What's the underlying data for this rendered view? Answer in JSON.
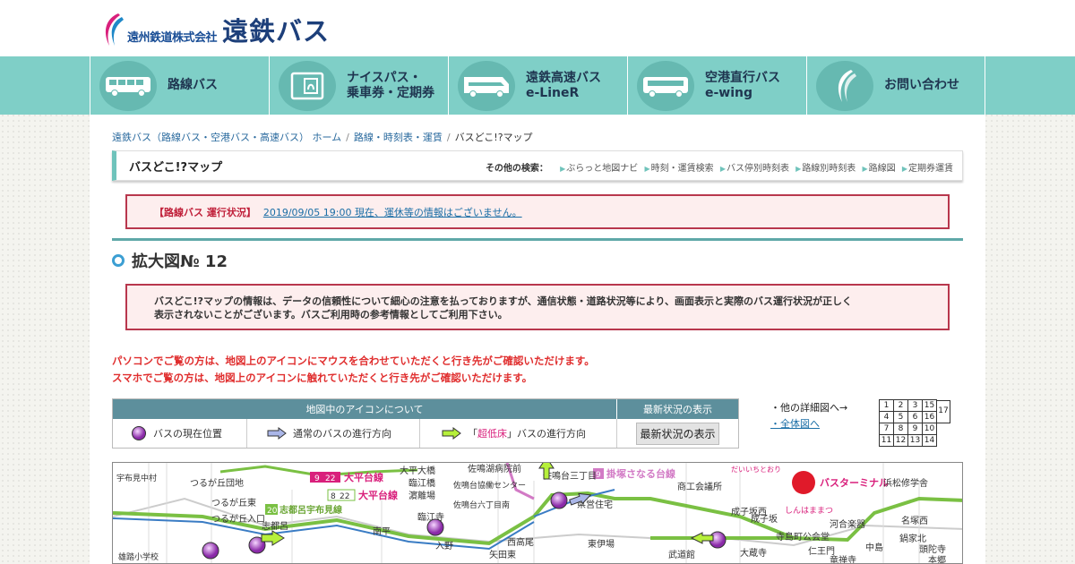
{
  "header": {
    "company": "遠州鉄道株式会社",
    "brand": "遠鉄バス",
    "colors": {
      "brand_blue": "#1d3f7a",
      "accent_pink": "#d9207c",
      "accent_teal": "#7fcfc7"
    }
  },
  "nav": {
    "items": [
      {
        "label1": "路線バス",
        "label2": "",
        "icon": "bus-icon"
      },
      {
        "label1": "ナイスパス・",
        "label2": "乗車券・定期券",
        "icon": "card-icon"
      },
      {
        "label1": "遠鉄高速バス",
        "label2": "e-LineR",
        "icon": "highway-bus-icon"
      },
      {
        "label1": "空港直行バス",
        "label2": "e-wing",
        "icon": "airport-bus-icon"
      },
      {
        "label1": "お問い合わせ",
        "label2": "",
        "icon": "contact-icon"
      }
    ]
  },
  "breadcrumb": {
    "home": "遠鉄バス（路線バス・空港バス・高速バス） ホーム",
    "second": "路線・時刻表・運賃",
    "current": "バスどこ!?マップ",
    "sep": "/"
  },
  "title_bar": {
    "title": "バスどこ!?マップ",
    "other_label": "その他の検索：",
    "links": [
      "ぶらっと地図ナビ",
      "時刻・運賃検索",
      "バス停別時刻表",
      "路線別時刻表",
      "路線図",
      "定期券運賃"
    ]
  },
  "status": {
    "label": "【路線バス 運行状況】",
    "text": "2019/09/05 19:00 現在、運休等の情報はございません。"
  },
  "section": {
    "title": "拡大図№ 12"
  },
  "notice": {
    "line1": "バスどこ!?マップの情報は、データの信頼性について細心の注意を払っておりますが、通信状態・道路状況等により、画面表示と実際のバス運行状況が正しく",
    "line2": "表示されないことがございます。バスご利用時の参考情報としてご利用下さい。"
  },
  "instructions": {
    "pc": "パソコンでご覧の方は、地図上のアイコンにマウスを合わせていただくと行き先がご確認いただけます。",
    "sp": "スマホでご覧の方は、地図上のアイコンに触れていただくと行き先がご確認いただけます。"
  },
  "icon_table": {
    "head_icons": "地図中のアイコンについて",
    "head_latest": "最新状況の表示",
    "bus_position": "バスの現在位置",
    "normal_dir": "通常のバスの進行方向",
    "low_floor_prefix": "「",
    "low_floor_word": "超低床",
    "low_floor_suffix": "」バスの進行方向",
    "latest_button": "最新状況の表示"
  },
  "detail": {
    "other_maps": "・他の詳細図へ→",
    "full_map": "・全体図へ"
  },
  "grid_map": {
    "rows": [
      [
        "1",
        "2",
        "3",
        "15"
      ],
      [
        "4",
        "5",
        "6",
        "16"
      ],
      [
        "7",
        "8",
        "9",
        "10"
      ],
      [
        "11",
        "12",
        "13",
        "14"
      ]
    ],
    "side": "17",
    "current": "12"
  },
  "map": {
    "lines": [
      {
        "num": "9",
        "sub": "22",
        "name": "大平台線"
      },
      {
        "num": "8",
        "sub": "22",
        "name": "大平台線"
      },
      {
        "num": "20",
        "sub": "",
        "name": "志都呂宇布見線"
      },
      {
        "num": "9",
        "sub": "",
        "name": "掛塚さなる台線"
      }
    ],
    "labels": [
      "つるが丘団地",
      "つるが丘東",
      "つるが丘入口",
      "志都呂",
      "大平大橋",
      "臨江橋",
      "濵離場",
      "佐鳴湖病院前",
      "佐鳴台協働センター",
      "佐鳴台六丁目南",
      "佐鳴台三丁目",
      "県営住宅",
      "商工会議所",
      "成子坂西",
      "成子坂",
      "バスターミナル",
      "浜松修学舎",
      "しんはままつ",
      "だいいちとおり",
      "寺島町公会堂",
      "仁王門",
      "河合楽器",
      "名塚西",
      "鍋家北",
      "頭陀寺",
      "雄踏小学校",
      "宇布見中村",
      "入野",
      "矢田東",
      "西高尾",
      "南平",
      "臨江寺",
      "大蔵寺",
      "東伊場",
      "武道館",
      "中島",
      "竜禅寺",
      "本郷"
    ]
  }
}
